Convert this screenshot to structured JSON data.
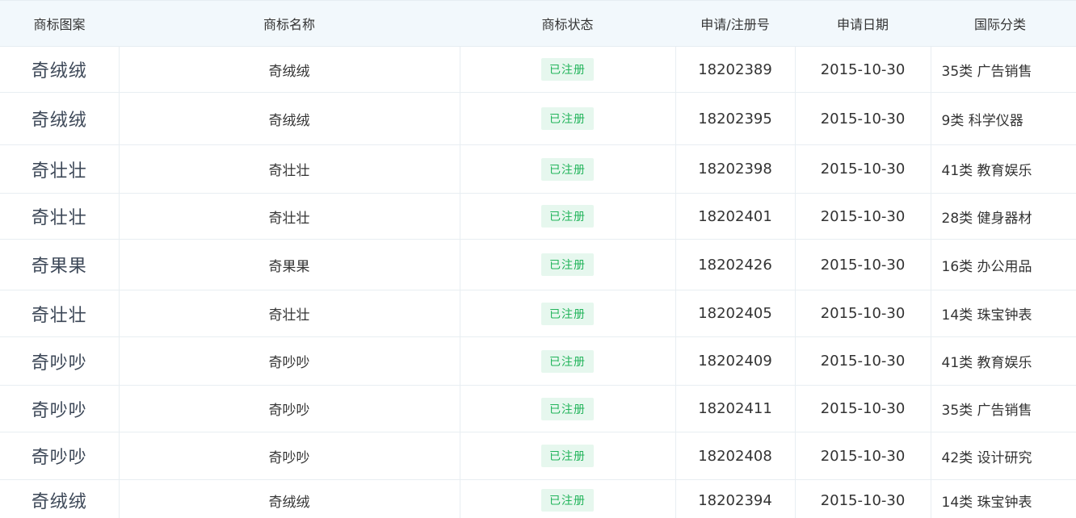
{
  "header": {
    "logo": "商标图案",
    "name": "商标名称",
    "status": "商标状态",
    "reg_no": "申请/注册号",
    "date": "申请日期",
    "intl_class": "国际分类"
  },
  "rows": [
    {
      "logo": "奇绒绒",
      "name": "奇绒绒",
      "status": "已注册",
      "reg_no": "18202389",
      "date": "2015-10-30",
      "intl_class": "35类 广告销售"
    },
    {
      "logo": "奇绒绒",
      "name": "奇绒绒",
      "status": "已注册",
      "reg_no": "18202395",
      "date": "2015-10-30",
      "intl_class": "9类 科学仪器"
    },
    {
      "logo": "奇壮壮",
      "name": "奇壮壮",
      "status": "已注册",
      "reg_no": "18202398",
      "date": "2015-10-30",
      "intl_class": "41类 教育娱乐"
    },
    {
      "logo": "奇壮壮",
      "name": "奇壮壮",
      "status": "已注册",
      "reg_no": "18202401",
      "date": "2015-10-30",
      "intl_class": "28类 健身器材"
    },
    {
      "logo": "奇果果",
      "name": "奇果果",
      "status": "已注册",
      "reg_no": "18202426",
      "date": "2015-10-30",
      "intl_class": "16类 办公用品"
    },
    {
      "logo": "奇壮壮",
      "name": "奇壮壮",
      "status": "已注册",
      "reg_no": "18202405",
      "date": "2015-10-30",
      "intl_class": "14类 珠宝钟表"
    },
    {
      "logo": "奇吵吵",
      "name": "奇吵吵",
      "status": "已注册",
      "reg_no": "18202409",
      "date": "2015-10-30",
      "intl_class": "41类 教育娱乐"
    },
    {
      "logo": "奇吵吵",
      "name": "奇吵吵",
      "status": "已注册",
      "reg_no": "18202411",
      "date": "2015-10-30",
      "intl_class": "35类 广告销售"
    },
    {
      "logo": "奇吵吵",
      "name": "奇吵吵",
      "status": "已注册",
      "reg_no": "18202408",
      "date": "2015-10-30",
      "intl_class": "42类 设计研究"
    },
    {
      "logo": "奇绒绒",
      "name": "奇绒绒",
      "status": "已注册",
      "reg_no": "18202394",
      "date": "2015-10-30",
      "intl_class": "14类 珠宝钟表"
    }
  ],
  "colors": {
    "header_bg": "#f2f8fc",
    "badge_bg": "#e6f7ee",
    "badge_text": "#22b45b",
    "border": "#e8eef2"
  }
}
